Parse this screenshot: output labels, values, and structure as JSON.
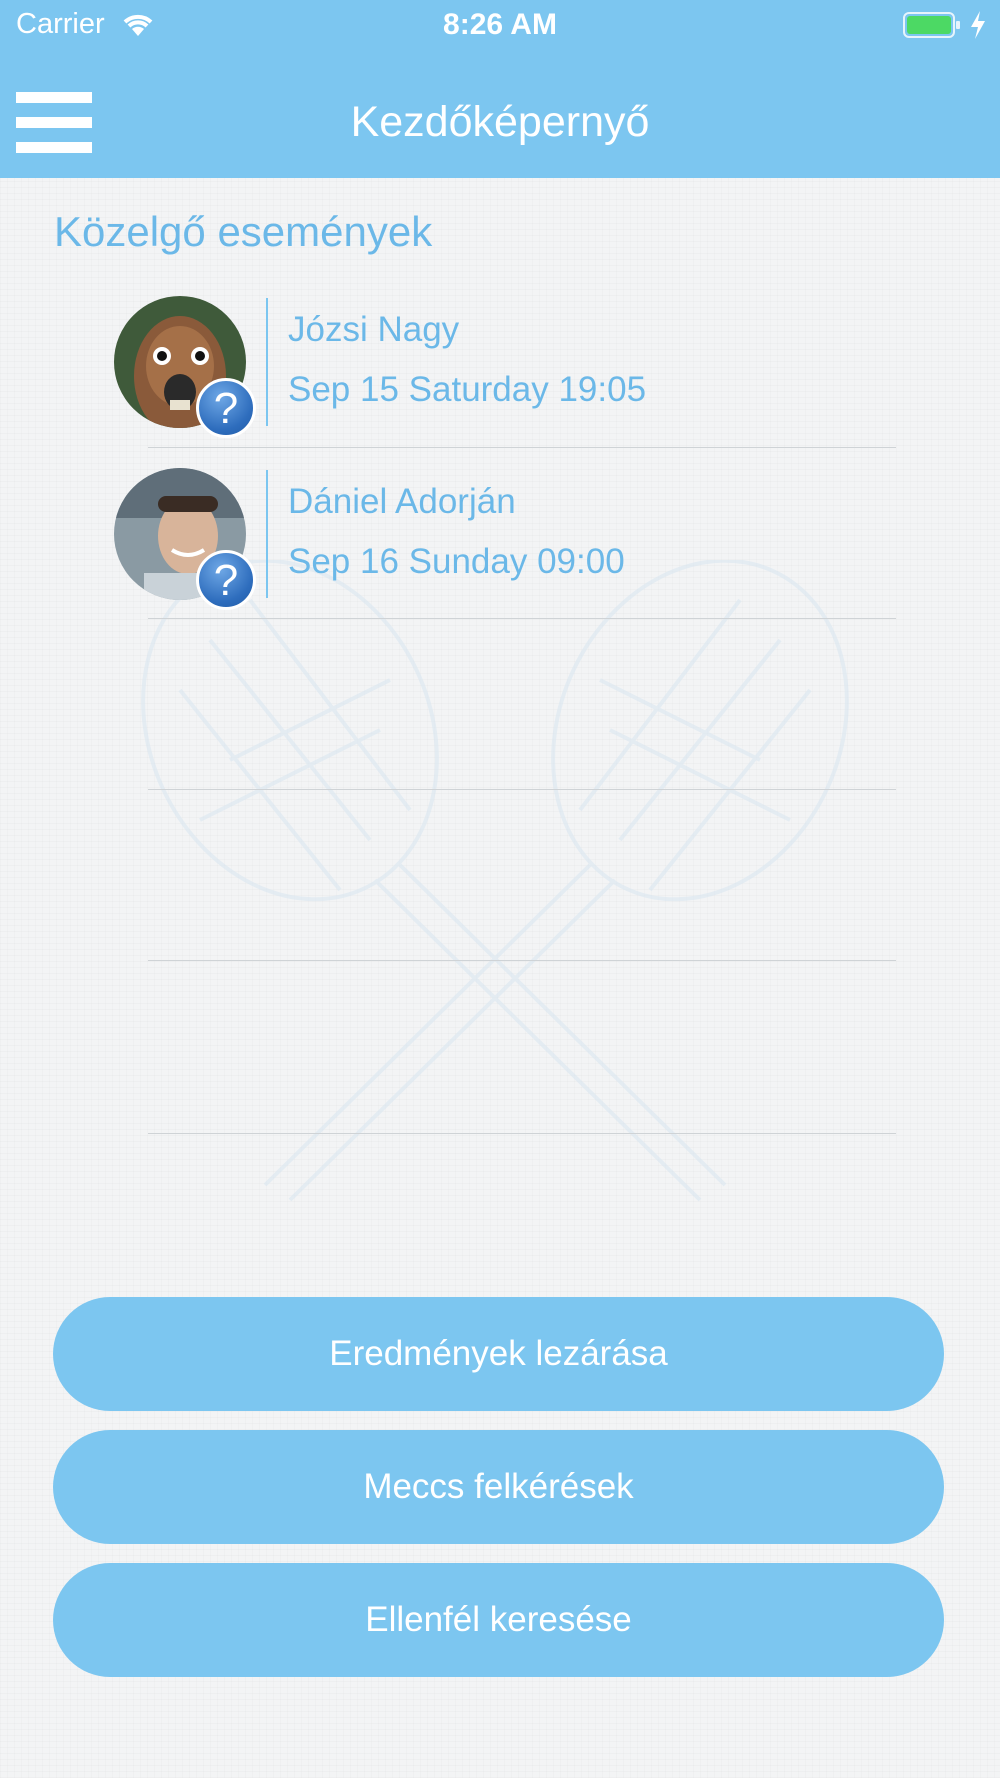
{
  "status_bar": {
    "carrier": "Carrier",
    "time": "8:26 AM"
  },
  "nav": {
    "title": "Kezdőképernyő"
  },
  "section": {
    "title": "Közelgő események"
  },
  "events": [
    {
      "name": "Józsi Nagy",
      "date": "Sep 15 Saturday 19:05",
      "status_icon": "question-badge-icon"
    },
    {
      "name": "Dániel Adorján",
      "date": "Sep 16 Sunday 09:00",
      "status_icon": "question-badge-icon"
    }
  ],
  "badge_glyph": "?",
  "buttons": {
    "close_results": "Eredmények lezárása",
    "match_requests": "Meccs felkérések",
    "find_opponent": "Ellenfél keresése"
  },
  "colors": {
    "accent": "#7cc6f0",
    "text_accent": "#6bb8e8",
    "badge": "#2e6dbd"
  }
}
